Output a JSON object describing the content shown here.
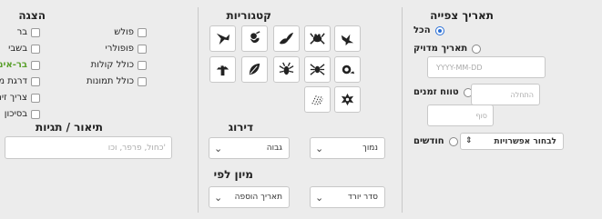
{
  "display": {
    "title": "הצגה",
    "right_column": [
      {
        "label": "בר",
        "green": false
      },
      {
        "label": "בשבי",
        "green": false
      },
      {
        "label": "בר-אימות",
        "green": true
      },
      {
        "label": "דרגת מחקר",
        "green": false
      },
      {
        "label": "צריך זיהוי",
        "green": false
      },
      {
        "label": "בסיכון",
        "green": false
      }
    ],
    "left_column": [
      {
        "label": "פולש"
      },
      {
        "label": "פופולרי"
      },
      {
        "label": "כולל קולות"
      },
      {
        "label": "כולל תמונות"
      }
    ]
  },
  "description": {
    "title": "תיאור / תגיות",
    "placeholder": "'כחול, פרפר, וכו"
  },
  "categories": {
    "title": "קטגוריות",
    "icons": [
      "bird-icon",
      "amphibian-icon",
      "reptile-icon",
      "mammal-icon",
      "fish-icon",
      "mollusk-icon",
      "spider-icon",
      "insect-icon",
      "plant-icon",
      "fungus-icon",
      "protozoa-icon",
      "unknown-icon"
    ]
  },
  "grade": {
    "title": "דירוג",
    "high_label": "גבוה",
    "low_label": "נמוך"
  },
  "sort": {
    "title": "מיון לפי",
    "field_label": "תאריך הוספה",
    "order_label": "סדר יורד"
  },
  "date": {
    "title": "תאריך צפייה",
    "all_label": "הכל",
    "exact_label": "תאריך מדויק",
    "exact_placeholder": "YYYY-MM-DD",
    "range_label": "טווח זמנים",
    "start_placeholder": "התחלה",
    "end_placeholder": "סוף",
    "months_label": "חודשים",
    "months_select": "לבחור אפשרויות"
  },
  "colors": {
    "accent": "#2a6fd6",
    "green": "#5aa02c",
    "icon": "#222222"
  }
}
